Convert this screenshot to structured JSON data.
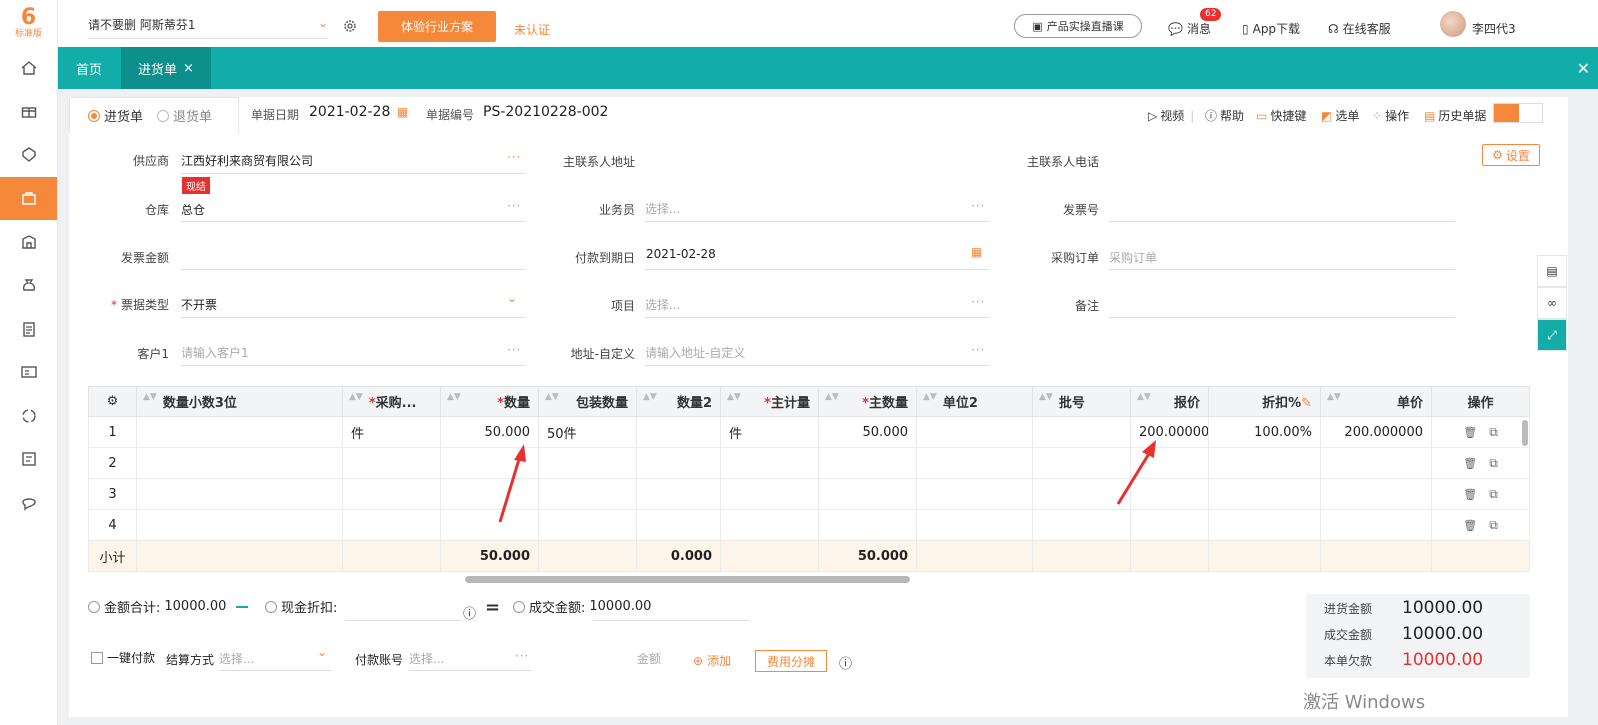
{
  "sidebar": {
    "logo_text": "标准版",
    "items": [
      "home-icon",
      "gift-icon",
      "shield-icon",
      "bag-icon",
      "building-icon",
      "money-bag-icon",
      "clipboard-icon",
      "id-card-icon",
      "refresh-icon",
      "report-icon",
      "chat-icon"
    ]
  },
  "topbar": {
    "company": "请不要删 阿斯蒂芬1",
    "trial_label": "体验行业方案",
    "unauth_label": "未认证",
    "live_label": "产品实操直播课",
    "msg_label": "消息",
    "msg_count": "62",
    "app_label": "App下载",
    "service_label": "在线客服",
    "username": "李四代3"
  },
  "tabbar": {
    "home": "首页",
    "active": "进货单",
    "close": "×"
  },
  "doc": {
    "type_purchase": "进货单",
    "type_return": "退货单",
    "date_label": "单据日期",
    "date_value": "2021-02-28",
    "no_label": "单据编号",
    "no_value": "PS-20210228-002"
  },
  "tools": {
    "video": "视频",
    "help": "帮助",
    "shortcut": "快捷键",
    "select": "选单",
    "operate": "操作",
    "history": "历史单据",
    "settings": "设置"
  },
  "form": {
    "supplier_label": "供应商",
    "supplier_value": "江西好利来商贸有限公司",
    "cash_tag": "现结",
    "contact_addr_label": "主联系人地址",
    "contact_phone_label": "主联系人电话",
    "warehouse_label": "仓库",
    "warehouse_value": "总仓",
    "salesman_label": "业务员",
    "salesman_ph": "选择...",
    "invoice_no_label": "发票号",
    "invoice_amt_label": "发票金额",
    "due_label": "付款到期日",
    "due_value": "2021-02-28",
    "po_label": "采购订单",
    "po_ph": "采购订单",
    "bill_type_label": "票据类型",
    "bill_type_value": "不开票",
    "project_label": "项目",
    "project_ph": "选择...",
    "remark_label": "备注",
    "customer_label": "客户1",
    "customer_ph": "请输入客户1",
    "address_label": "地址-自定义",
    "address_ph": "请输入地址-自定义"
  },
  "grid": {
    "headers": [
      "数量小数3位",
      "*采购...",
      "*数量",
      "包装数量",
      "数量2",
      "*主计量",
      "*主数量",
      "单位2",
      "批号",
      "报价",
      "折扣%",
      "单价",
      "操作"
    ],
    "rows": [
      {
        "no": "1",
        "dec3": "",
        "unit": "件",
        "qty": "50.000",
        "pack": "50件",
        "qty2": "",
        "main_unit": "件",
        "main_qty": "50.000",
        "unit2": "",
        "batch": "",
        "quote": "200.000000",
        "disc": "100.00%",
        "price": "200.000000"
      },
      {
        "no": "2",
        "dec3": "",
        "unit": "",
        "qty": "",
        "pack": "",
        "qty2": "",
        "main_unit": "",
        "main_qty": "",
        "unit2": "",
        "batch": "",
        "quote": "",
        "disc": "",
        "price": ""
      },
      {
        "no": "3",
        "dec3": "",
        "unit": "",
        "qty": "",
        "pack": "",
        "qty2": "",
        "main_unit": "",
        "main_qty": "",
        "unit2": "",
        "batch": "",
        "quote": "",
        "disc": "",
        "price": ""
      },
      {
        "no": "4",
        "dec3": "",
        "unit": "",
        "qty": "",
        "pack": "",
        "qty2": "",
        "main_unit": "",
        "main_qty": "",
        "unit2": "",
        "batch": "",
        "quote": "",
        "disc": "",
        "price": ""
      }
    ],
    "subtotal_label": "小计",
    "subtotal_qty": "50.000",
    "subtotal_qty2": "0.000",
    "subtotal_main_qty": "50.000"
  },
  "footer": {
    "amount_label": "金额合计:",
    "amount_value": "10000.00",
    "discount_label": "现金折扣:",
    "deal_label": "成交金额:",
    "deal_value": "10000.00",
    "onekey_label": "一键付款",
    "settle_label": "结算方式",
    "settle_ph": "选择...",
    "account_label": "付款账号",
    "account_ph": "选择...",
    "amount_field_label": "金额",
    "add_label": "添加",
    "fee_label": "费用分摊"
  },
  "summary": {
    "purchase_label": "进货金额",
    "purchase_value": "10000.00",
    "deal_label": "成交金额",
    "deal_value": "10000.00",
    "owe_label": "本单欠款",
    "owe_value": "10000.00"
  },
  "os_watermark": "激活 Windows",
  "colors": {
    "accent": "#f5883b",
    "teal": "#12ada8",
    "red": "#e9302e"
  }
}
